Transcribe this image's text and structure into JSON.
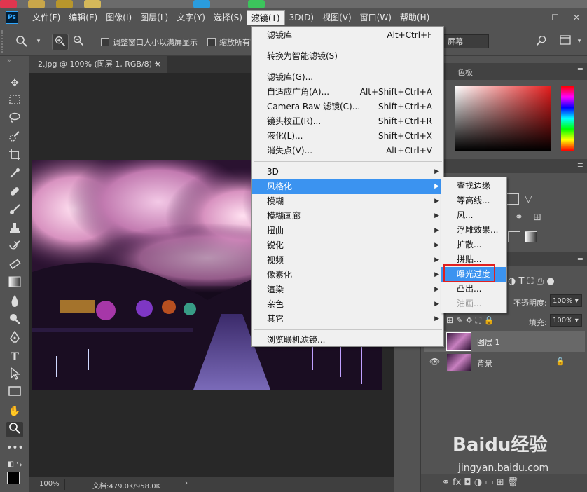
{
  "app": {
    "logo": "Ps",
    "menu": [
      "文件(F)",
      "编辑(E)",
      "图像(I)",
      "图层(L)",
      "文字(Y)",
      "选择(S)",
      "滤镜(T)",
      "3D(D)",
      "视图(V)",
      "窗口(W)",
      "帮助(H)"
    ],
    "active_menu_index": 6,
    "window_controls": [
      "—",
      "☐",
      "✕"
    ]
  },
  "options": {
    "resize_windows_label": "调整窗口大小以满屏显示",
    "zoom_all_label": "缩放所有窗",
    "fill_screen_label": "屏幕"
  },
  "document": {
    "tab_title": "2.jpg @ 100% (图层 1, RGB/8) *",
    "tab_close": "×",
    "zoom": "100%",
    "doc_size": "文档:479.0K/958.0K",
    "status_arrow": "›"
  },
  "panels": {
    "color_tab": "色板",
    "opacity_label": "不透明度:",
    "opacity_value": "100%",
    "fill_label": "填充:",
    "fill_value": "100%",
    "layers": [
      {
        "name": "图层 1",
        "visible": false,
        "locked": false
      },
      {
        "name": "背景",
        "visible": true,
        "locked": true
      }
    ]
  },
  "filter_menu": {
    "items": [
      {
        "label": "滤镜库",
        "shortcut": "Alt+Ctrl+F"
      },
      {
        "sep": true
      },
      {
        "label": "转换为智能滤镜(S)",
        "shortcut": ""
      },
      {
        "sep": true
      },
      {
        "label": "滤镜库(G)...",
        "shortcut": ""
      },
      {
        "label": "自适应广角(A)...",
        "shortcut": "Alt+Shift+Ctrl+A"
      },
      {
        "label": "Camera Raw 滤镜(C)...",
        "shortcut": "Shift+Ctrl+A"
      },
      {
        "label": "镜头校正(R)...",
        "shortcut": "Shift+Ctrl+R"
      },
      {
        "label": "液化(L)...",
        "shortcut": "Shift+Ctrl+X"
      },
      {
        "label": "消失点(V)...",
        "shortcut": "Alt+Ctrl+V"
      },
      {
        "sep": true
      },
      {
        "label": "3D",
        "submenu": true
      },
      {
        "label": "风格化",
        "submenu": true,
        "highlighted": true
      },
      {
        "label": "模糊",
        "submenu": true
      },
      {
        "label": "模糊画廊",
        "submenu": true
      },
      {
        "label": "扭曲",
        "submenu": true
      },
      {
        "label": "锐化",
        "submenu": true
      },
      {
        "label": "视频",
        "submenu": true
      },
      {
        "label": "像素化",
        "submenu": true
      },
      {
        "label": "渲染",
        "submenu": true
      },
      {
        "label": "杂色",
        "submenu": true
      },
      {
        "label": "其它",
        "submenu": true
      },
      {
        "sep": true
      },
      {
        "label": "浏览联机滤镜...",
        "shortcut": ""
      }
    ]
  },
  "stylize_submenu": {
    "items": [
      {
        "label": "查找边缘"
      },
      {
        "label": "等高线..."
      },
      {
        "label": "风..."
      },
      {
        "label": "浮雕效果..."
      },
      {
        "label": "扩散..."
      },
      {
        "label": "拼贴..."
      },
      {
        "label": "曝光过度",
        "highlighted": true
      },
      {
        "label": "凸出..."
      },
      {
        "label": "油画...",
        "disabled": true
      }
    ]
  },
  "watermark": {
    "brand": "Baidu经验",
    "url": "jingyan.baidu.com"
  },
  "colors": {
    "menu_highlight": "#3b93f0",
    "annotation_box": "#e02020",
    "ui_bg": "#535353"
  }
}
